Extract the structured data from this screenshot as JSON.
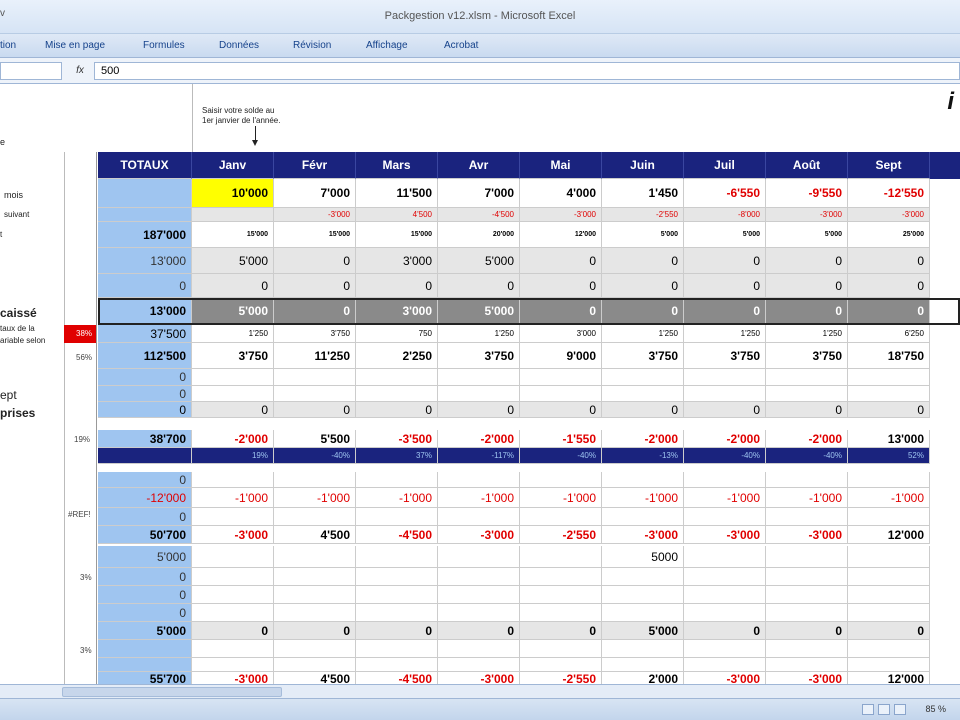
{
  "window": {
    "title": "Packgestion v12.xlsm - Microsoft Excel",
    "title_left": "v"
  },
  "ribbon_tabs": [
    "tion",
    "Mise en page",
    "Formules",
    "Données",
    "Révision",
    "Affichage",
    "Acrobat"
  ],
  "formula_bar": {
    "name_box": "",
    "fx": "fx",
    "value": "500"
  },
  "note": "Saisir votre solde au\n1er janvier de l'année.",
  "logo": "i",
  "left_labels": {
    "l1": "e",
    "l2": "mois",
    "l3": "suivant",
    "l4": "t",
    "l5": "caissé",
    "l6": "taux de la",
    "l7": "ariable selon",
    "l8": "ept",
    "l9": "prises"
  },
  "pct_labels": {
    "p1": "38%",
    "p2": "56%",
    "p3": "19%",
    "p4": "#REF!",
    "p5": "3%",
    "p6": "3%"
  },
  "headers": [
    "TOTAUX",
    "Janv",
    "Févr",
    "Mars",
    "Avr",
    "Mai",
    "Juin",
    "Juil",
    "Août",
    "Sept"
  ],
  "rows": [
    {
      "cells": [
        "",
        "10'000",
        "7'000",
        "11'500",
        "7'000",
        "4'000",
        "1'450",
        "-6'550",
        "-9'550",
        "-12'550"
      ]
    },
    {
      "cells": [
        "",
        "",
        "-3'000",
        "4'500",
        "-4'500",
        "-3'000",
        "-2'550",
        "-8'000",
        "-3'000",
        "-3'000"
      ]
    },
    {
      "cells": [
        "187'000",
        "15'000",
        "15'000",
        "15'000",
        "20'000",
        "12'000",
        "5'000",
        "5'000",
        "5'000",
        "25'000"
      ]
    },
    {
      "cells": [
        "13'000",
        "5'000",
        "0",
        "3'000",
        "5'000",
        "0",
        "0",
        "0",
        "0",
        "0"
      ]
    },
    {
      "cells": [
        "0",
        "0",
        "0",
        "0",
        "0",
        "0",
        "0",
        "0",
        "0",
        "0"
      ]
    },
    {
      "cells": [
        "13'000",
        "5'000",
        "0",
        "3'000",
        "5'000",
        "0",
        "0",
        "0",
        "0",
        "0"
      ]
    },
    {
      "cells": [
        "37'500",
        "1'250",
        "3'750",
        "750",
        "1'250",
        "3'000",
        "1'250",
        "1'250",
        "1'250",
        "6'250"
      ]
    },
    {
      "cells": [
        "112'500",
        "3'750",
        "11'250",
        "2'250",
        "3'750",
        "9'000",
        "3'750",
        "3'750",
        "3'750",
        "18'750"
      ]
    },
    {
      "cells": [
        "0",
        "",
        "",
        "",
        "",
        "",
        "",
        "",
        "",
        ""
      ]
    },
    {
      "cells": [
        "0",
        "",
        "",
        "",
        "",
        "",
        "",
        "",
        "",
        ""
      ]
    },
    {
      "cells": [
        "0",
        "0",
        "0",
        "0",
        "0",
        "0",
        "0",
        "0",
        "0",
        "0"
      ]
    },
    {
      "cells": [
        "38'700",
        "-2'000",
        "5'500",
        "-3'500",
        "-2'000",
        "-1'550",
        "-2'000",
        "-2'000",
        "-2'000",
        "13'000"
      ]
    },
    {
      "cells": [
        "",
        "19%",
        "-40%",
        "37%",
        "-117%",
        "-40%",
        "-13%",
        "-40%",
        "-40%",
        "52%"
      ]
    },
    {
      "cells": [
        "0",
        "",
        "",
        "",
        "",
        "",
        "",
        "",
        "",
        ""
      ]
    },
    {
      "cells": [
        "-12'000",
        "-1'000",
        "-1'000",
        "-1'000",
        "-1'000",
        "-1'000",
        "-1'000",
        "-1'000",
        "-1'000",
        "-1'000"
      ]
    },
    {
      "cells": [
        "0",
        "",
        "",
        "",
        "",
        "",
        "",
        "",
        "",
        ""
      ]
    },
    {
      "cells": [
        "50'700",
        "-3'000",
        "4'500",
        "-4'500",
        "-3'000",
        "-2'550",
        "-3'000",
        "-3'000",
        "-3'000",
        "12'000"
      ]
    },
    {
      "cells": [
        "5'000",
        "",
        "",
        "",
        "",
        "",
        "5000",
        "",
        "",
        ""
      ]
    },
    {
      "cells": [
        "0",
        "",
        "",
        "",
        "",
        "",
        "",
        "",
        "",
        ""
      ]
    },
    {
      "cells": [
        "0",
        "",
        "",
        "",
        "",
        "",
        "",
        "",
        "",
        ""
      ]
    },
    {
      "cells": [
        "0",
        "",
        "",
        "",
        "",
        "",
        "",
        "",
        "",
        ""
      ]
    },
    {
      "cells": [
        "5'000",
        "0",
        "0",
        "0",
        "0",
        "0",
        "5'000",
        "0",
        "0",
        "0"
      ]
    },
    {
      "cells": [
        "",
        "",
        "",
        "",
        "",
        "",
        "",
        "",
        "",
        ""
      ]
    },
    {
      "cells": [
        "",
        "",
        "",
        "",
        "",
        "",
        "",
        "",
        "",
        ""
      ]
    },
    {
      "cells": [
        "55'700",
        "-3'000",
        "4'500",
        "-4'500",
        "-3'000",
        "-2'550",
        "2'000",
        "-3'000",
        "-3'000",
        "12'000"
      ]
    }
  ],
  "status": {
    "zoom": "85 %"
  },
  "colors": {
    "header": "#1a237e",
    "total_col": "#9fc5f0",
    "highlight": "#ffff00",
    "negative": "#e00000",
    "dark_row": "#8a8a8a",
    "red_marker": "#e00000"
  }
}
